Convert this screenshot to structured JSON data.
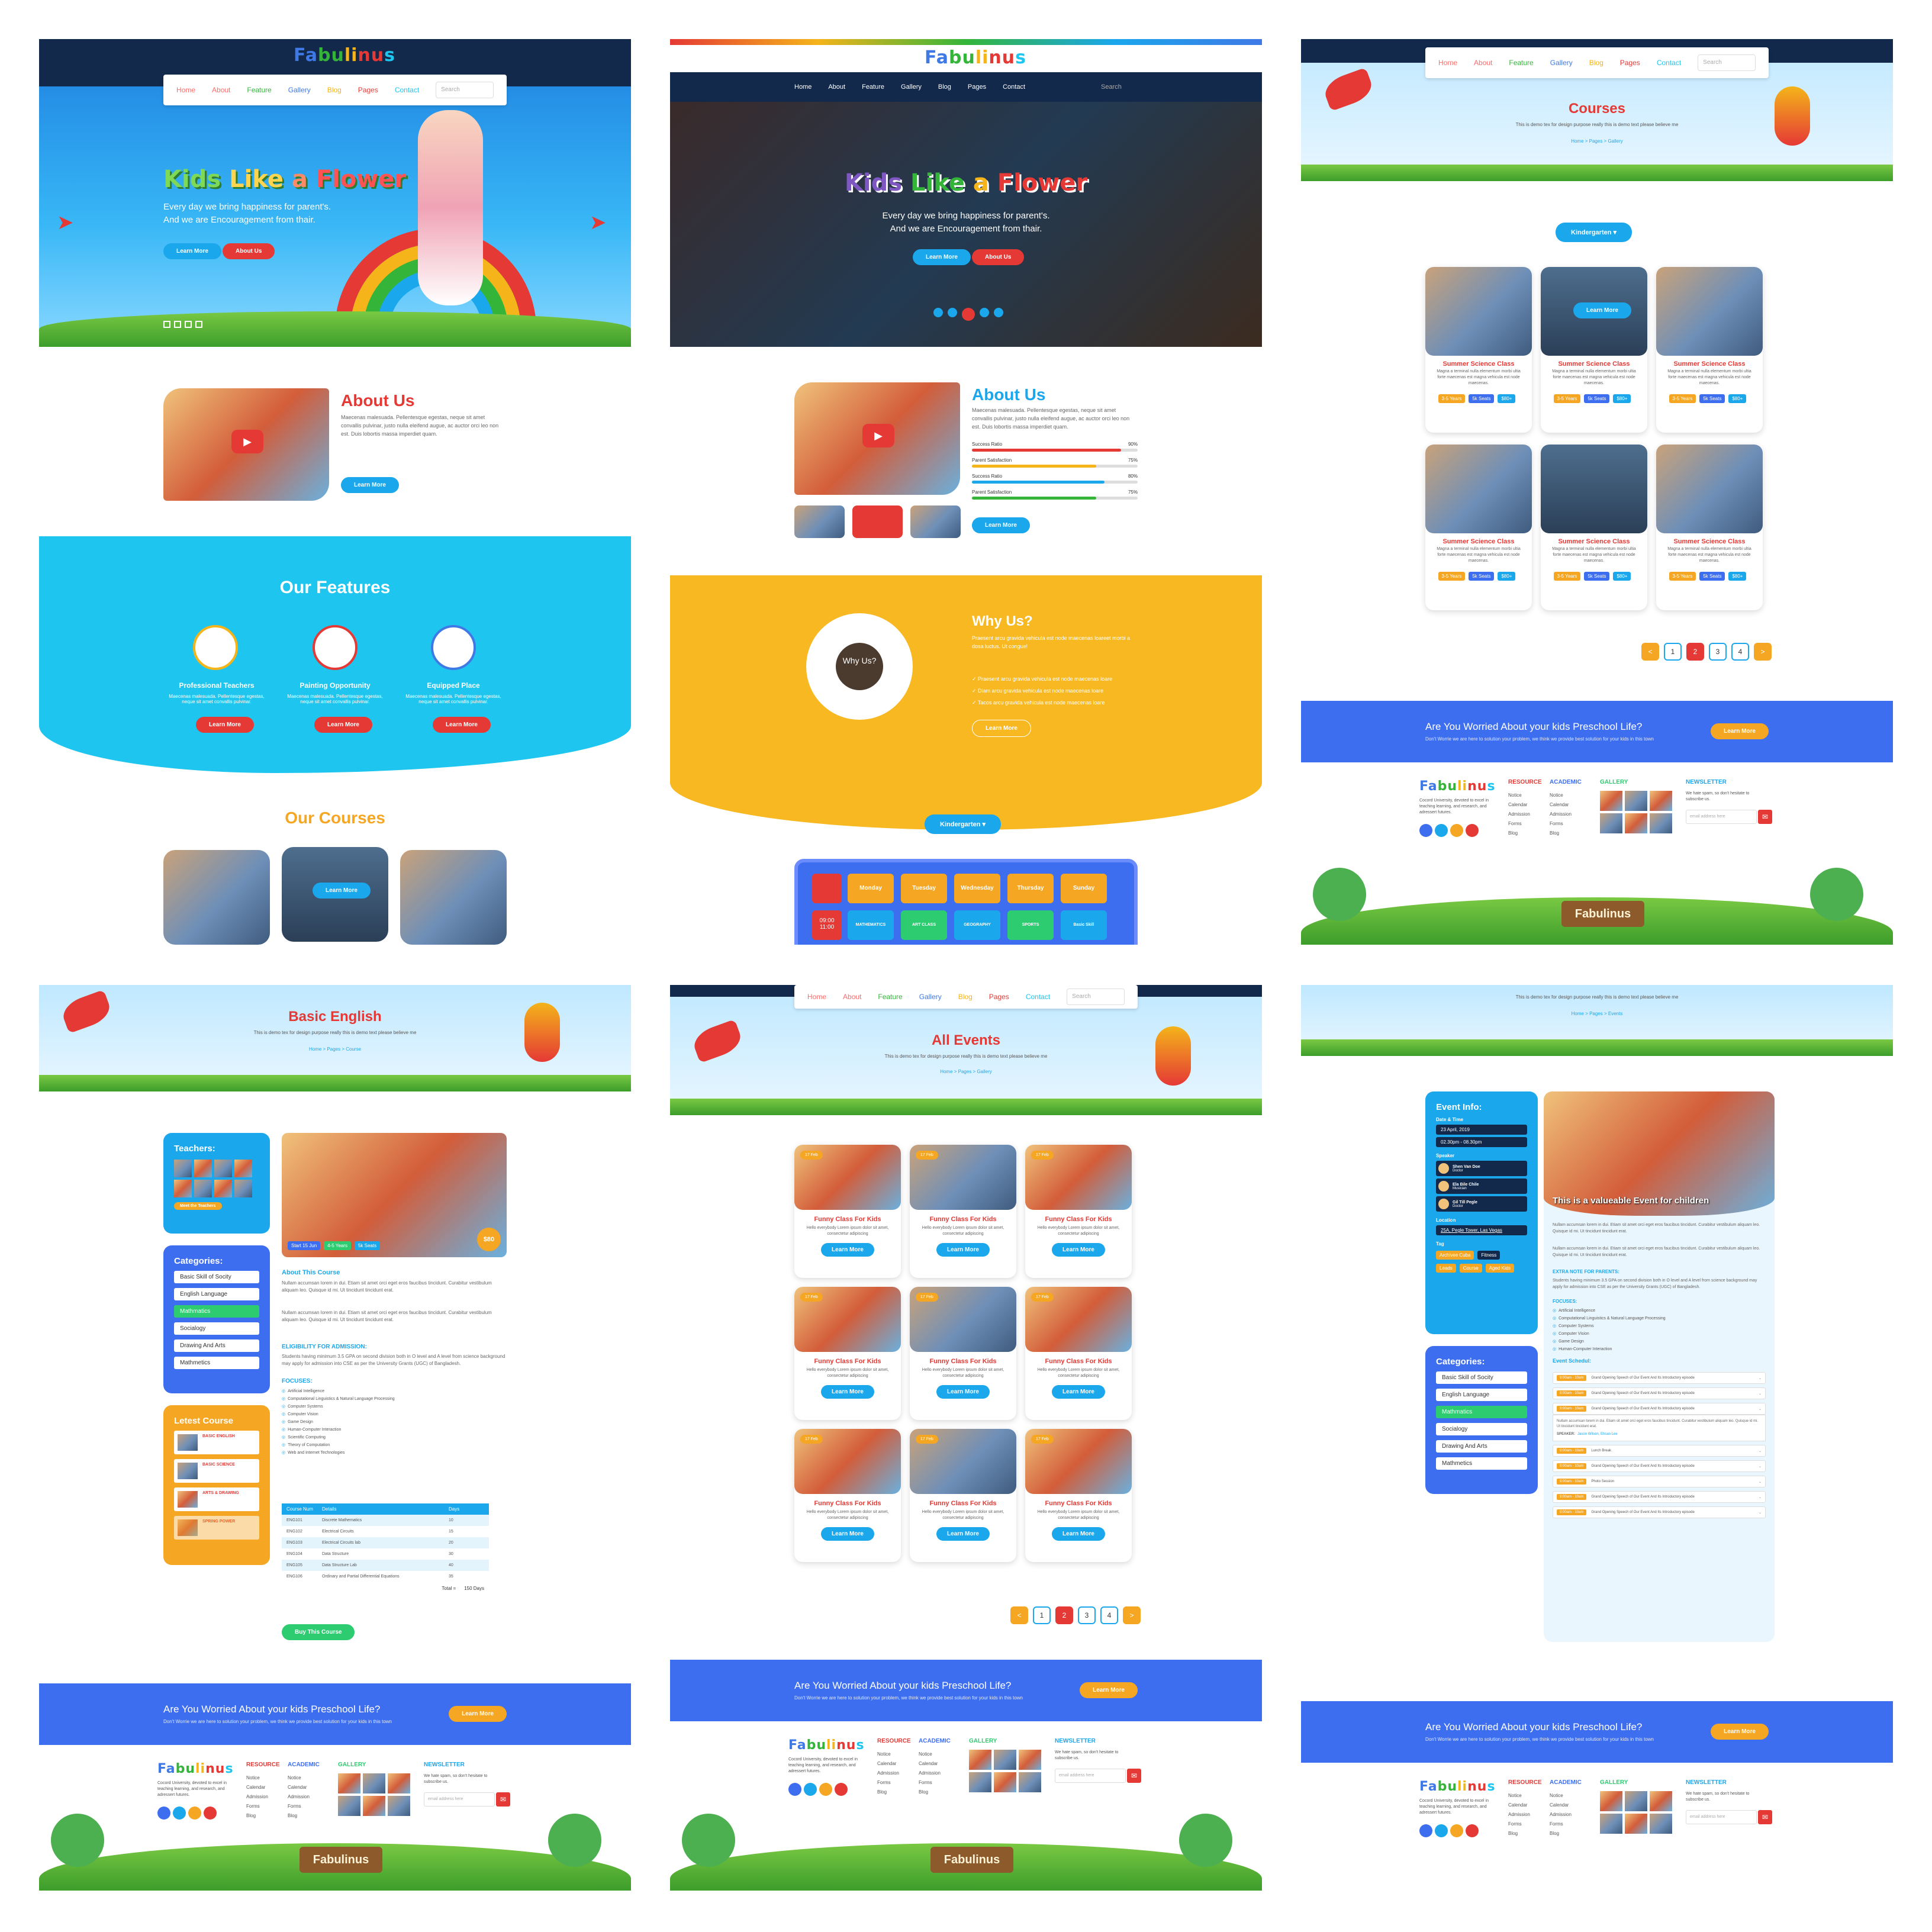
{
  "brand": {
    "logo": "Fabulinus"
  },
  "nav": {
    "items": [
      "Home",
      "About",
      "Feature",
      "Gallery",
      "Blog",
      "Pages",
      "Contact"
    ],
    "search_placeholder": "Search"
  },
  "hero": {
    "title_parts": [
      "Kids",
      "Like",
      "a",
      "Flower"
    ],
    "subtitle_1": "Every day we bring happiness for parent's.",
    "subtitle_2": "And we are Encouragement from thair.",
    "btn_learn": "Learn More",
    "btn_about": "About Us"
  },
  "about": {
    "title": "About Us",
    "text": "Maecenas malesuada. Pellentesque egestas, neque sit amet convallis pulvinar, justo nulla eleifend augue, ac auctor orci leo non est. Duis lobortis massa imperdiet quam.",
    "btn": "Learn More",
    "skills": [
      {
        "label": "Success Ratio",
        "value": "90%",
        "pct": 90,
        "color": "#e53935"
      },
      {
        "label": "Parent Satisfaction",
        "value": "75%",
        "pct": 75,
        "color": "#f4b41a"
      },
      {
        "label": "Success Ratio",
        "value": "80%",
        "pct": 80,
        "color": "#1aa7ec"
      },
      {
        "label": "Parent Satisfaction",
        "value": "75%",
        "pct": 75,
        "color": "#34b53a"
      }
    ]
  },
  "features": {
    "title": "Our Features",
    "items": [
      {
        "title": "Professional Teachers",
        "btn": "Learn More"
      },
      {
        "title": "Painting Opportunity",
        "btn": "Learn More"
      },
      {
        "title": "Equipped Place",
        "btn": "Learn More"
      }
    ],
    "desc": "Maecenas malesuada. Pellentesque egestas, neque sit amet convallis pulvinar."
  },
  "courses_home": {
    "title": "Our Courses",
    "btn": "Learn More"
  },
  "why": {
    "title": "Why Us?",
    "badge": "Why Us?",
    "text": "Praesent arcu gravida vehicula est node maecenas loareet morbi a dosa luctus. Ut congue!",
    "points": [
      "Praesent arcu gravida vehicula est node maecenas loare",
      "Diam arcu gravida vehicula est node maecenas loare",
      "Tacos arcu gravida vehicula est node maecenas loare"
    ],
    "btn": "Learn More"
  },
  "schedule": {
    "dropdown": "Kindergarten",
    "days": [
      "Monday",
      "Tuesday",
      "Wednesday",
      "Thursday",
      "Sunday"
    ],
    "time": "09:00 11:00",
    "subjects": [
      "MATHEMATICS",
      "ART CLASS",
      "GEOGRAPHY",
      "SPORTS",
      "Basic Skill"
    ]
  },
  "courses_page": {
    "title": "Courses",
    "subtitle": "This is demo tex for design purpose really this is demo text please believe me",
    "crumb": "Home > Pages > Gallery",
    "dropdown": "Kindergarten",
    "card_title": "Summer Science Class",
    "card_text": "Magna a terminal nulla elementum morbi ultia forte maecenas est magna vehicula est node maecenas.",
    "tags": [
      "3-5 Years",
      "5k Seats",
      "$80+"
    ],
    "hover_btn": "Learn More"
  },
  "pagination": {
    "prev": "<",
    "pages": [
      "1",
      "2",
      "3",
      "4"
    ],
    "next": ">"
  },
  "cta": {
    "title": "Are You Worried About your kids Preschool Life?",
    "sub": "Don't Worrie we are here to solution your problem, we think we provide best solution for your kids in this town",
    "btn": "Learn More"
  },
  "footer": {
    "about": "Cocord University, devoted to excel in teaching learning, and research, and adressert futures.",
    "col_resource": "RESOURCE",
    "col_academic": "ACADEMIC",
    "col_gallery": "GALLERY",
    "col_newsletter": "NEWSLETTER",
    "resource_links": [
      "Notice",
      "Calendar",
      "Admission",
      "Forms",
      "Blog"
    ],
    "academic_links": [
      "Notice",
      "Calendar",
      "Admission",
      "Forms",
      "Blog"
    ],
    "newsletter_text": "We hate spam, so don't hesitate to subscribe us.",
    "email_placeholder": "email address here",
    "sign": "Fabulinus"
  },
  "course_detail": {
    "title": "Basic English",
    "subtitle": "This is demo tex for design purpose really this is demo text please believe me",
    "crumb": "Home > Pages > Course",
    "teachers_title": "Teachers:",
    "teachers_btn": "Meet the Teachers",
    "categories_title": "Categories:",
    "categories": [
      "Basic Skill of Socity",
      "English Language",
      "Mathmatics",
      "Socialogy",
      "Drawing And Arts",
      "Mathmetics"
    ],
    "latest_title": "Letest Course",
    "latest": [
      "BASIC ENGLISH",
      "BASIC SCIENCE",
      "ARTS & DRAWING",
      "SPRING POWER"
    ],
    "info_tags": [
      "Start 15 Jun",
      "4-5 Years",
      "5k Seats"
    ],
    "price": "$80",
    "about_title": "About This Course",
    "about_text": "Nullam accumsan lorem in dui. Etiam sit amet orci eget eros faucibus tincidunt. Curabitur vestibulum aliquam leo. Quisque id mi. Ut tincidunt tincidunt erat.",
    "eligibility_title": "ELIGIBILITY FOR ADMISSION:",
    "eligibility_text": "Students having minimum 3.5 GPA on second division both in O level and A level from science background may apply for admission into CSE as per the University Grants (UGC) of Bangladesh.",
    "focuses_title": "FOCUSES:",
    "focuses": [
      "Artificial Intelligence",
      "Computational Linguistics & Natural Language Processing",
      "Computer Systems",
      "Computer Vision",
      "Game Design",
      "Human-Computer Interaction",
      "Scientific Computing",
      "Theory of Computation",
      "Web and Internet Technologies"
    ],
    "table_headers": [
      "Course Num",
      "Details",
      "Days"
    ],
    "table_rows": [
      [
        "ENG101",
        "Discrete Mathematics",
        "10"
      ],
      [
        "ENG102",
        "Electrical Circuits",
        "15"
      ],
      [
        "ENG103",
        "Electrical Circuits lab",
        "20"
      ],
      [
        "ENG104",
        "Data Structure",
        "30"
      ],
      [
        "ENG105",
        "Data Structure Lab",
        "40"
      ],
      [
        "ENG106",
        "Ordinary and Partial Differential Equations",
        "35"
      ]
    ],
    "total_label": "Total =",
    "total_value": "150 Days",
    "buy_btn": "Buy This Course"
  },
  "events": {
    "title": "All Events",
    "subtitle": "This is demo tex for design purpose really this is demo text please believe me",
    "crumb": "Home > Pages > Gallery",
    "card_date": "17 Feb",
    "card_title": "Funny Class For Kids",
    "card_text": "Hello everybody Lorem ipsum dolor sit amet, consectetur adipiscing",
    "card_btn": "Learn More"
  },
  "event_detail": {
    "subtitle": "This is demo tex for design purpose really this is demo text please believe me",
    "crumb": "Home > Pages > Events",
    "info_title": "Event Info:",
    "date_label": "Date & Time",
    "date": "23 April, 2019",
    "time": "02.30pm - 08.30pm",
    "speaker_label": "Speaker",
    "speakers": [
      {
        "name": "Shen Van Doe",
        "role": "Doctor"
      },
      {
        "name": "Ela Bile Chile",
        "role": "Musician"
      },
      {
        "name": "Gil Till Pegle",
        "role": "Doctor"
      }
    ],
    "location_label": "Location",
    "location": "25A, Pegle Tower, Las Vegas",
    "tag_label": "Tag",
    "tags": [
      "Archivee Cuba",
      "Fitness",
      "Leads",
      "Course",
      "Aged Kids"
    ],
    "categories_title": "Categories:",
    "categories": [
      "Basic Skill of Socity",
      "English Language",
      "Mathmatics",
      "Socialogy",
      "Drawing And Arts",
      "Mathmetics"
    ],
    "banner_title": "This is a valueable Event for children",
    "extra_title": "EXTRA NOTE FOR PARENTS:",
    "focuses_title": "FOCUSES:",
    "focuses": [
      "Artificial Intelligence",
      "Computational Linguistics & Natural Language Processing",
      "Computer Systems",
      "Computer Vision",
      "Game Design",
      "Human-Computer Interaction"
    ],
    "schedule_title": "Event Schedul:",
    "schedule": [
      "Grand Opening Speech of Our Event And Its Introductory episode",
      "Grand Opening Speech of Our Event And Its Introductory episode",
      "Grand Opening Speech of Our Event And Its Introductory episode",
      "Lunch Break",
      "Grand Opening Speech of Our Event And Its Introductory episode",
      "Photo Session",
      "Grand Opening Speech of Our Event And Its Introductory episode",
      "Grand Opening Speech of Our Event And Its Introductory episode"
    ],
    "schedule_time": "9:00am - 10am",
    "speaker_line": "SPEAKER:",
    "speaker_line_names": "Jason Wilson, Ehsan Lee"
  }
}
